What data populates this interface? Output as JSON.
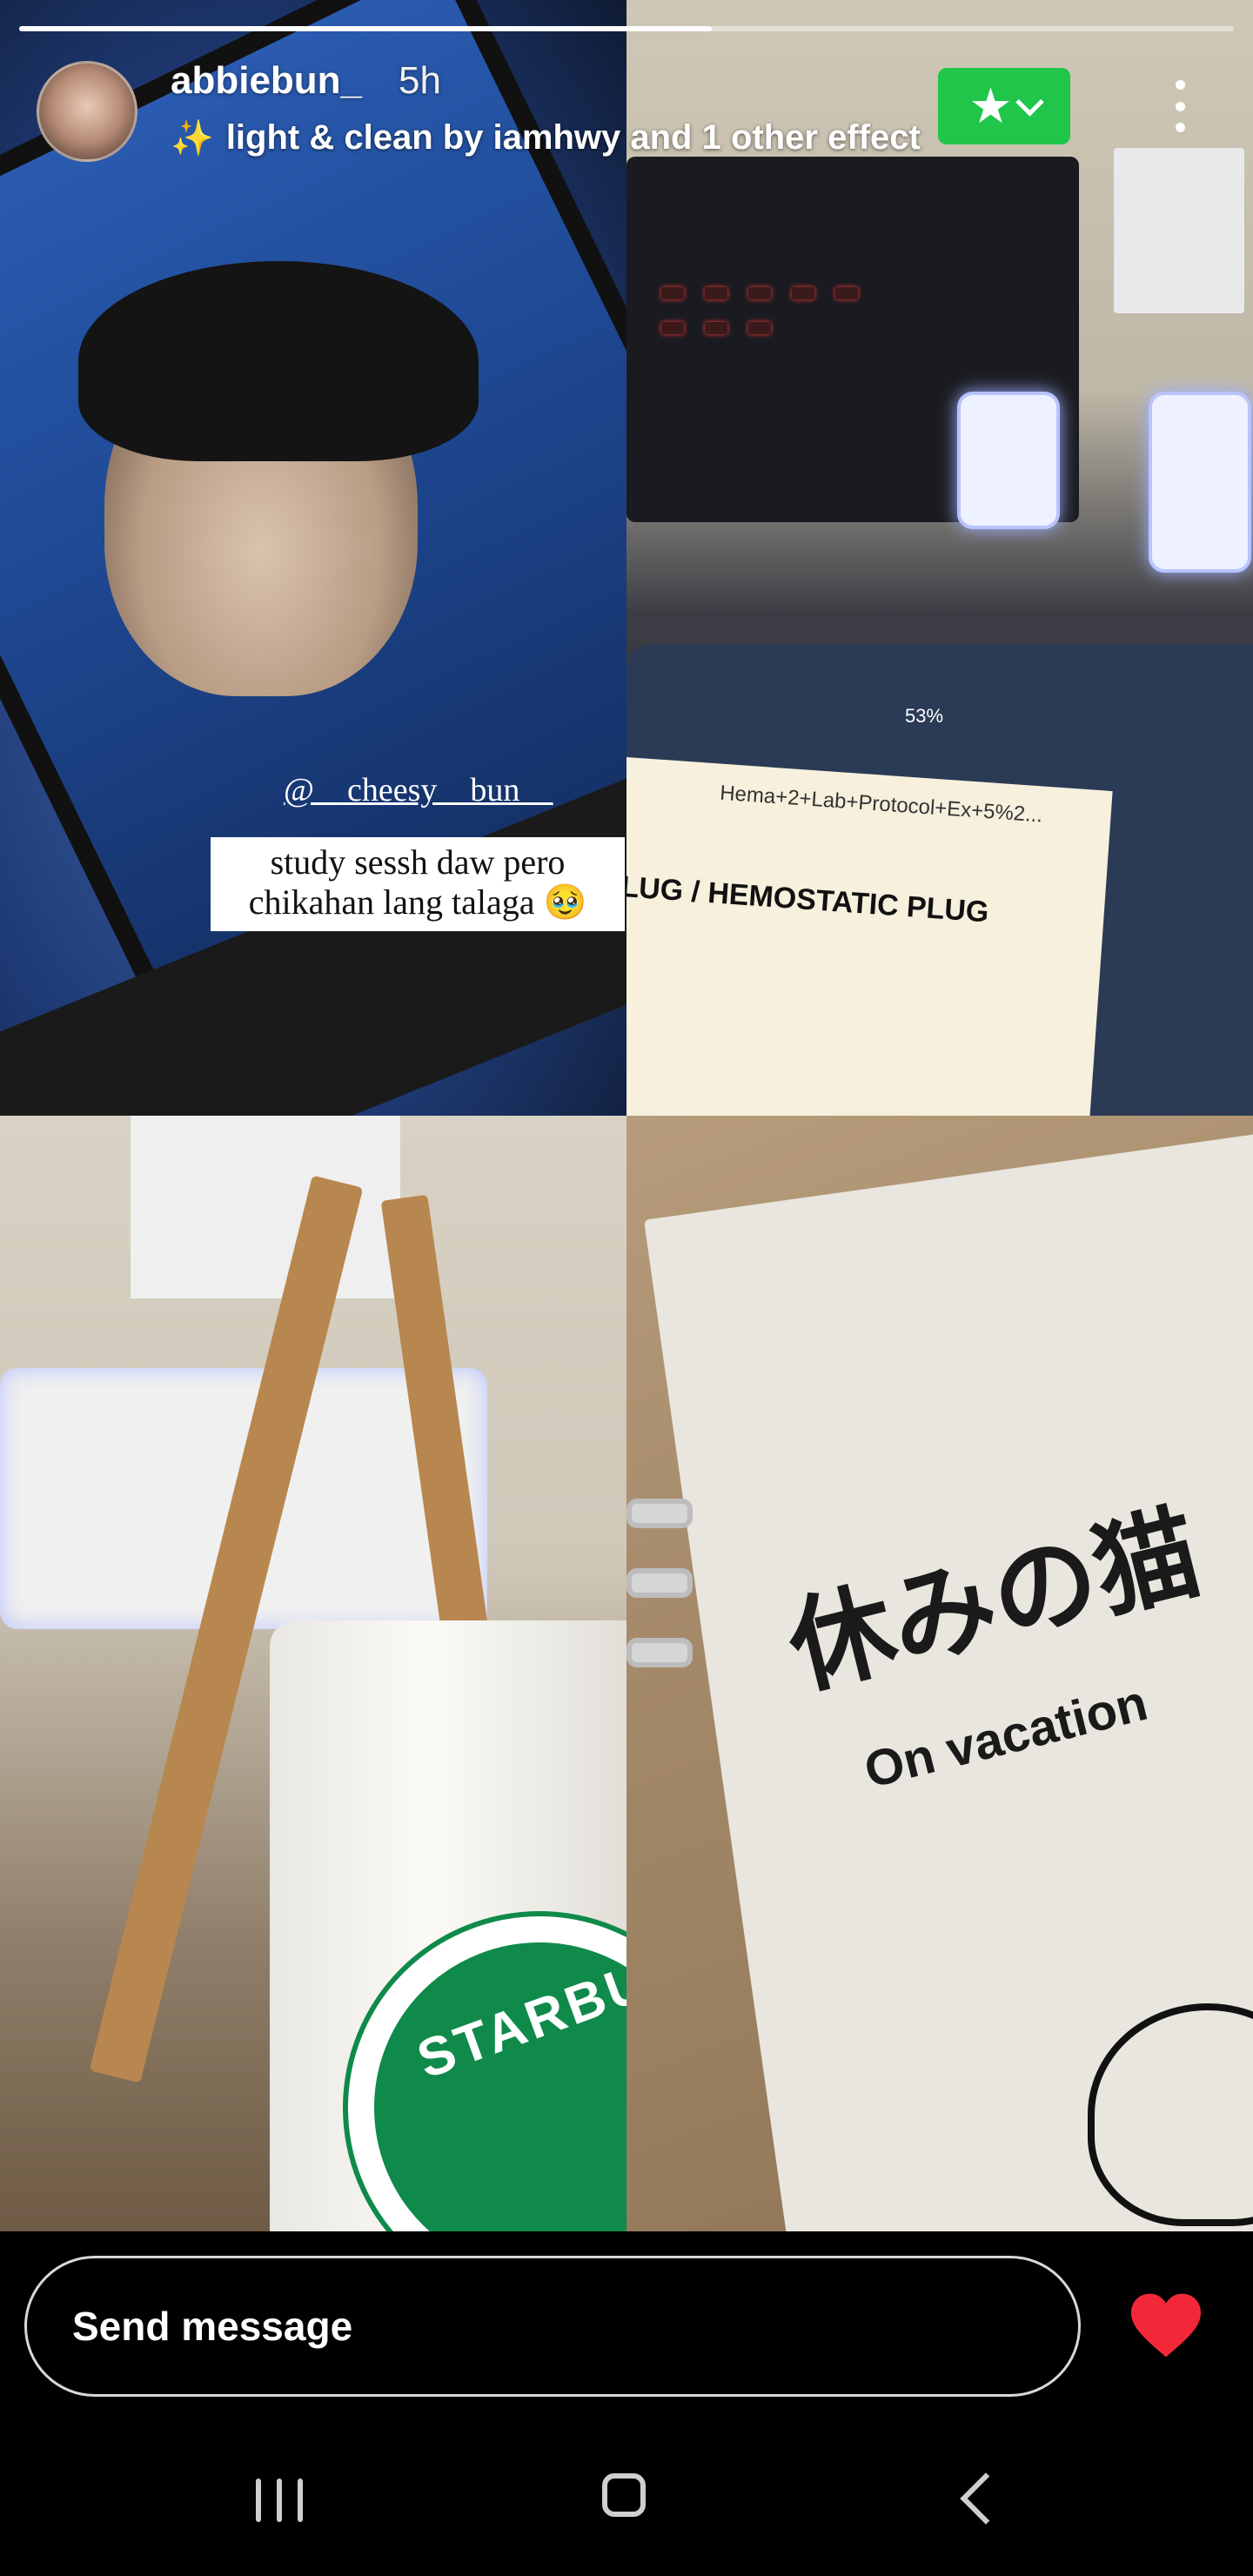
{
  "story": {
    "progress": 0.57,
    "username": "abbiebun_",
    "time_ago": "5h",
    "effect_label": "light & clean by iamhwy and 1 other effect",
    "mention": "@__cheesy__bun__",
    "caption_line1": "study sessh daw pero",
    "caption_line2": "chikahan lang talaga 🥹",
    "photo_text": {
      "doc_title": "Hema+2+Lab+Protocol+Ex+5%2...",
      "doc_heading": "LUG / HEMOSTATIC PLUG",
      "battery": "53%",
      "notebook_jp": "休みの猫",
      "notebook_en": "On vacation",
      "mug_brand": "STARBUCKS"
    }
  },
  "icons": {
    "sparkle": "sparkle-icon",
    "star": "star-icon",
    "more": "more-vertical-icon",
    "heart": "heart-icon"
  },
  "colors": {
    "badge_green": "#1fc64a",
    "heart_red": "#f2283a"
  },
  "footer": {
    "message_placeholder": "Send message"
  }
}
